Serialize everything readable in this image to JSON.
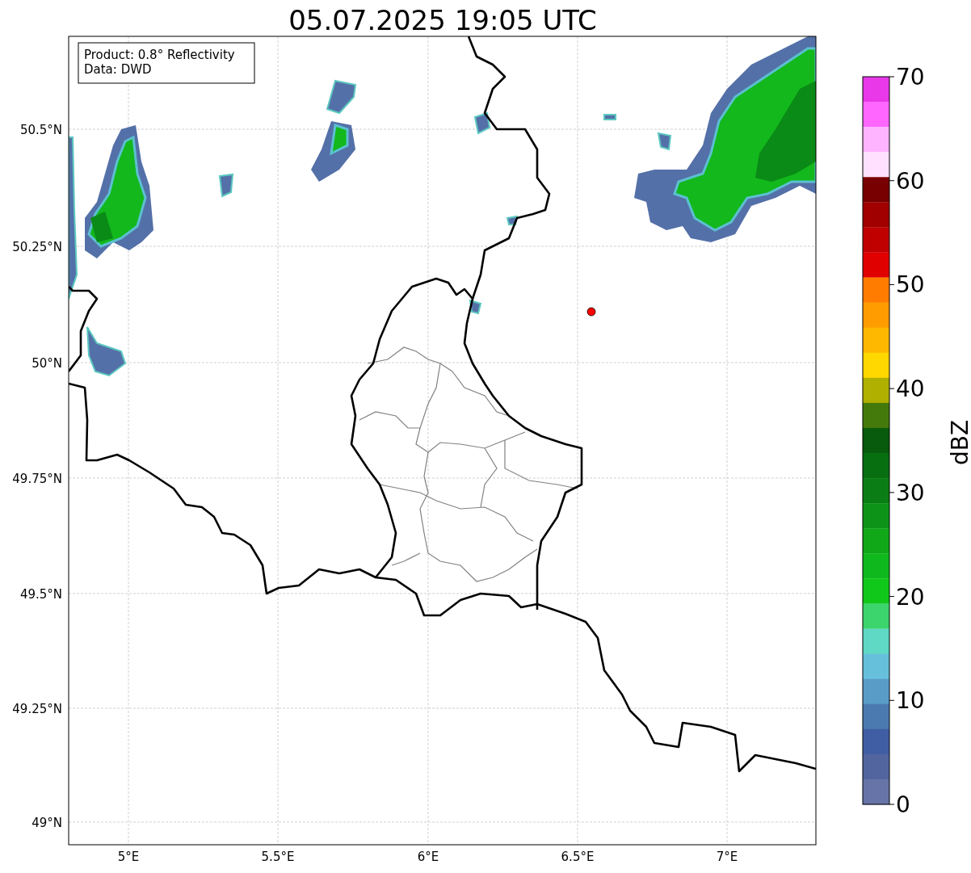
{
  "title": "05.07.2025 19:05 UTC",
  "info_box": {
    "lines": [
      "Product: 0.8° Reflectivity",
      "Data: DWD"
    ]
  },
  "map": {
    "lat_labels": [
      "50.5°N",
      "50.25°N",
      "50°N",
      "49.75°N",
      "49.5°N",
      "49.25°N",
      "49°N"
    ],
    "lon_labels": [
      "5°E",
      "5.5°E",
      "6°E",
      "6.5°E",
      "7°E"
    ]
  },
  "colorbar": {
    "label": "dBZ",
    "ticks": [
      "70",
      "60",
      "50",
      "40",
      "30",
      "20",
      "10",
      "0"
    ],
    "segments": [
      {
        "color": "#e838e8"
      },
      {
        "color": "#ff66ff"
      },
      {
        "color": "#ffb4ff"
      },
      {
        "color": "#ffe0ff"
      },
      {
        "color": "#780000"
      },
      {
        "color": "#a00000"
      },
      {
        "color": "#c00000"
      },
      {
        "color": "#e00000"
      },
      {
        "color": "#ff7c00"
      },
      {
        "color": "#ff9c00"
      },
      {
        "color": "#ffb800"
      },
      {
        "color": "#ffd800"
      },
      {
        "color": "#b0b000"
      },
      {
        "color": "#447a0c"
      },
      {
        "color": "#085a0c"
      },
      {
        "color": "#086f10"
      },
      {
        "color": "#0a7e14"
      },
      {
        "color": "#0d9418"
      },
      {
        "color": "#10a818"
      },
      {
        "color": "#0fb81c"
      },
      {
        "color": "#10c81a"
      },
      {
        "color": "#3cd46c"
      },
      {
        "color": "#5fd8c4"
      },
      {
        "color": "#66c0dc"
      },
      {
        "color": "#5a9cc8"
      },
      {
        "color": "#4a7ab0"
      },
      {
        "color": "#405ea3"
      },
      {
        "color": "#52659f"
      },
      {
        "color": "#6674a8"
      }
    ]
  }
}
